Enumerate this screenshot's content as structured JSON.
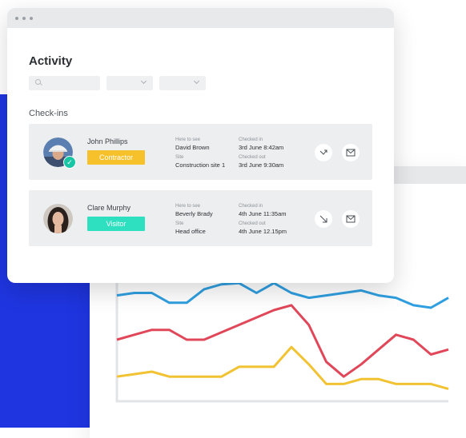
{
  "window": {
    "title": "Activity",
    "filters": [
      {
        "type": "search",
        "placeholder": ""
      },
      {
        "type": "select",
        "value": ""
      },
      {
        "type": "select",
        "value": ""
      }
    ]
  },
  "section_label": "Check-ins",
  "checkins": [
    {
      "name": "John Phillips",
      "type": "Contractor",
      "here_to_see_label": "Here to see",
      "here_to_see": "David Brown",
      "site_label": "Site",
      "site": "Construction site 1",
      "checked_in_label": "Checked in",
      "checked_in": "3rd June 8:42am",
      "checked_out_label": "Checked out",
      "checked_out": "3rd June 9:30am",
      "verified": true,
      "direction_icon": "arrow-up-right-icon"
    },
    {
      "name": "Clare Murphy",
      "type": "Visitor",
      "here_to_see_label": "Here to see",
      "here_to_see": "Beverly Brady",
      "site_label": "Site",
      "site": "Head office",
      "checked_in_label": "Checked in",
      "checked_in": "4th June 11:35am",
      "checked_out_label": "Checked out",
      "checked_out": "4th June 12.15pm",
      "verified": false,
      "direction_icon": "arrow-down-right-icon"
    }
  ],
  "colors": {
    "brand_blue": "#1f35e0",
    "contractor": "#f6c12a",
    "visitor": "#2ee0c0",
    "series_blue": "#2f9fe0",
    "series_red": "#e0485a",
    "series_yellow": "#f1c232"
  },
  "chart_data": {
    "type": "line",
    "title": "",
    "xlabel": "",
    "ylabel": "",
    "grid": false,
    "legend": "none",
    "ylim": [
      0,
      100
    ],
    "series": [
      {
        "values": [
          86,
          88,
          88,
          80,
          80,
          91,
          95,
          96,
          88,
          96,
          88,
          84,
          86,
          88,
          90,
          86,
          84,
          78,
          76,
          84
        ]
      },
      {
        "values": [
          50,
          54,
          58,
          58,
          50,
          50,
          56,
          62,
          68,
          74,
          78,
          62,
          32,
          20,
          30,
          42,
          54,
          50,
          38,
          42
        ]
      },
      {
        "values": [
          20,
          22,
          24,
          20,
          20,
          20,
          20,
          28,
          28,
          28,
          44,
          30,
          14,
          14,
          18,
          18,
          14,
          14,
          14,
          10
        ]
      }
    ]
  }
}
